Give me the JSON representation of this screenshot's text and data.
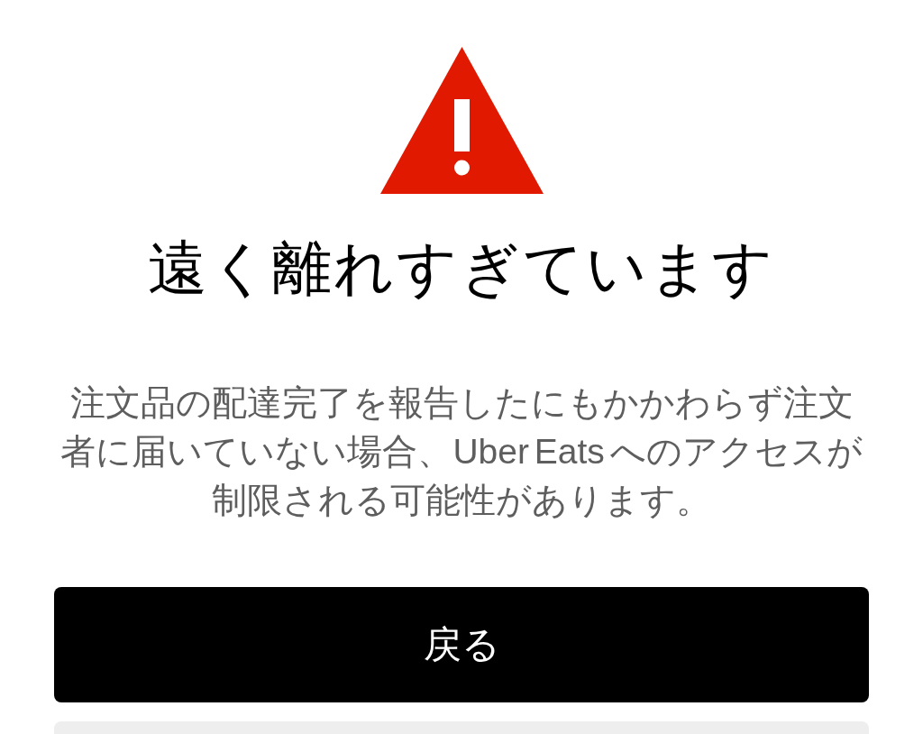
{
  "warning": {
    "title": "遠く離れすぎています",
    "message": "注文品の配達完了を報告したにもかかわらず注文者に届いていない場合、Uber Eats へのアクセスが制限される可能性があります。"
  },
  "buttons": [
    {
      "kind": "primary",
      "label": "戻る"
    },
    {
      "kind": "secondary"
    }
  ]
}
